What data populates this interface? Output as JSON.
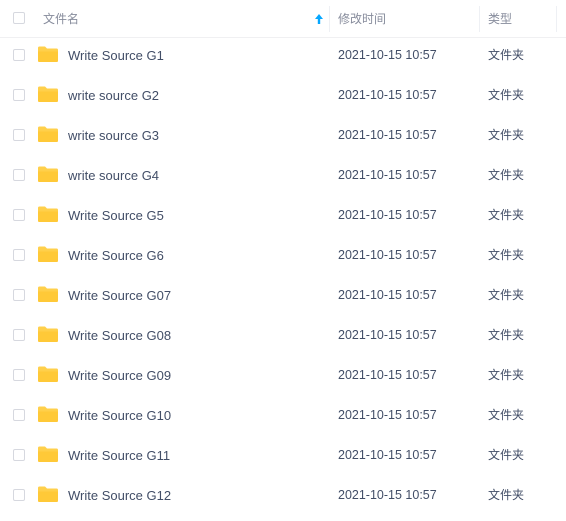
{
  "header": {
    "name_label": "文件名",
    "date_label": "修改时间",
    "type_label": "类型",
    "sort_icon": "arrow-up-icon",
    "accent_color": "#06a7ff"
  },
  "folder_color": "#ffd04b",
  "files": [
    {
      "name": "Write Source G1",
      "modified": "2021-10-15 10:57",
      "type": "文件夹"
    },
    {
      "name": "write source G2",
      "modified": "2021-10-15 10:57",
      "type": "文件夹"
    },
    {
      "name": "write source G3",
      "modified": "2021-10-15 10:57",
      "type": "文件夹"
    },
    {
      "name": "write source G4",
      "modified": "2021-10-15 10:57",
      "type": "文件夹"
    },
    {
      "name": "Write Source G5",
      "modified": "2021-10-15 10:57",
      "type": "文件夹"
    },
    {
      "name": "Write Source G6",
      "modified": "2021-10-15 10:57",
      "type": "文件夹"
    },
    {
      "name": "Write Source G07",
      "modified": "2021-10-15 10:57",
      "type": "文件夹"
    },
    {
      "name": "Write Source G08",
      "modified": "2021-10-15 10:57",
      "type": "文件夹"
    },
    {
      "name": "Write Source G09",
      "modified": "2021-10-15 10:57",
      "type": "文件夹"
    },
    {
      "name": "Write Source G10",
      "modified": "2021-10-15 10:57",
      "type": "文件夹"
    },
    {
      "name": "Write Source G11",
      "modified": "2021-10-15 10:57",
      "type": "文件夹"
    },
    {
      "name": "Write Source G12",
      "modified": "2021-10-15 10:57",
      "type": "文件夹"
    }
  ]
}
